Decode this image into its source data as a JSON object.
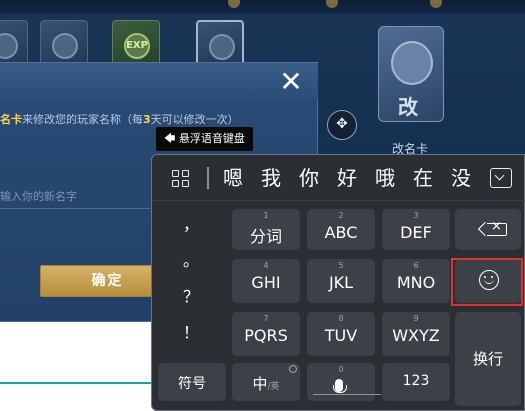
{
  "background": {
    "card_exp_label": "EXP",
    "big_card_glyph": "改",
    "card_caption": "改名卡",
    "dpad_glyph": "✥"
  },
  "dialog": {
    "close_glyph": "✕",
    "description_prefix": "名卡",
    "description_mid": "来修改您的玩家名称（每",
    "description_highlight": "3",
    "description_suffix": "天可以修改一次）",
    "name_placeholder": "输入你的新名字",
    "confirm_label": "确定"
  },
  "tooltip": {
    "icon": "back-arrow-icon",
    "label": "悬浮语音键盘"
  },
  "keyboard": {
    "candidates": [
      "嗯",
      "我",
      "你",
      "好",
      "哦",
      "在",
      "没"
    ],
    "punctuation": [
      "，",
      "。",
      "？",
      "！"
    ],
    "keys": {
      "k1": {
        "num": "1",
        "label": "分词"
      },
      "k2": {
        "num": "2",
        "label": "ABC"
      },
      "k3": {
        "num": "3",
        "label": "DEF"
      },
      "k4": {
        "num": "4",
        "label": "GHI"
      },
      "k5": {
        "num": "5",
        "label": "JKL"
      },
      "k6": {
        "num": "6",
        "label": "MNO"
      },
      "k7": {
        "num": "7",
        "label": "PQRS"
      },
      "k8": {
        "num": "8",
        "label": "TUV"
      },
      "k9": {
        "num": "9",
        "label": "WXYZ"
      },
      "k0": {
        "num": "0"
      }
    },
    "symbol_label": "符号",
    "lang_main": "中",
    "lang_sub": "/英",
    "num_label": "123",
    "enter_label": "换行"
  },
  "colors": {
    "highlight_frame": "#e0332e",
    "confirm_gold": "#c9a24f",
    "dialog_blue": "#274872"
  }
}
